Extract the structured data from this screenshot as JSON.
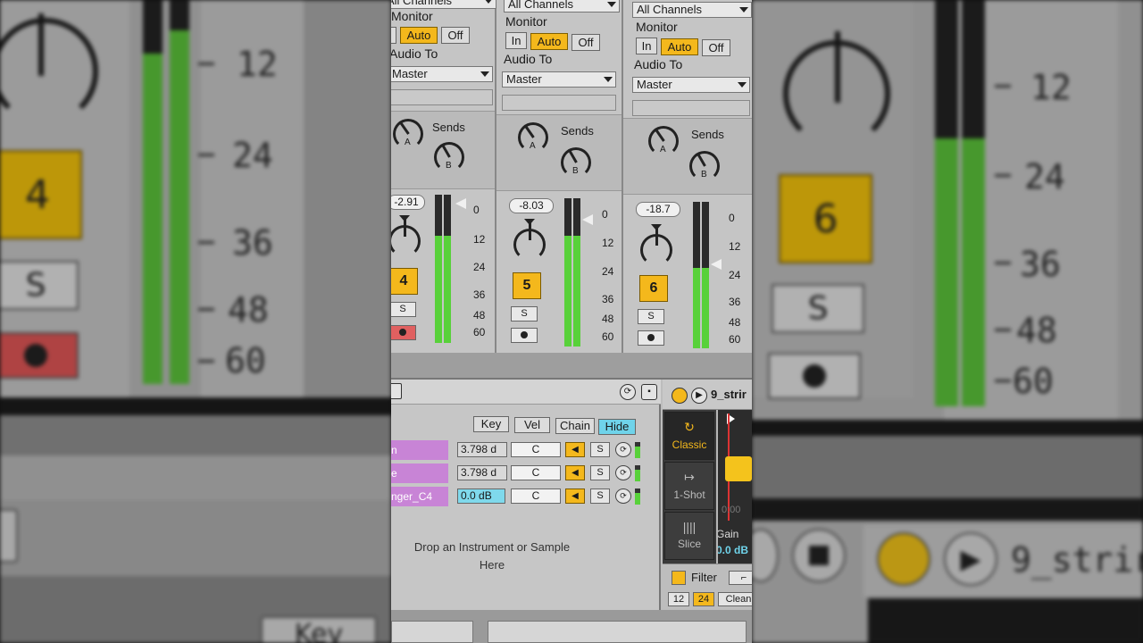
{
  "mixer": {
    "input_channel": "All Channels",
    "monitor_label": "Monitor",
    "monitor_in": "In",
    "monitor_auto": "Auto",
    "monitor_off": "Off",
    "audio_to_label": "Audio To",
    "audio_to_value": "Master",
    "sends_label": "Sends",
    "send_a": "A",
    "send_b": "B",
    "solo_label": "S",
    "scale": [
      "0",
      "12",
      "24",
      "36",
      "48",
      "60"
    ],
    "tracks": [
      {
        "volume": "-2.91",
        "number": "4",
        "meter_level": 0.72
      },
      {
        "volume": "-8.03",
        "number": "5",
        "meter_level": 0.75
      },
      {
        "volume": "-18.7",
        "number": "6",
        "meter_level": 0.55
      }
    ]
  },
  "drum_rack": {
    "key_label": "Key",
    "vel_label": "Vel",
    "chain_label": "Chain",
    "hide_label": "Hide",
    "chains": [
      {
        "name": "n",
        "volume": "3.798 d",
        "note": "C",
        "solo": "S"
      },
      {
        "name": "e",
        "volume": "3.798 d",
        "note": "C",
        "solo": "S"
      },
      {
        "name": "nger_C4",
        "volume": "0.0 dB",
        "note": "C",
        "solo": "S"
      }
    ],
    "drop_text_1": "Drop an Instrument or Sample",
    "drop_text_2": "Here"
  },
  "sampler": {
    "clip_name": "9_strir",
    "mode_classic": "Classic",
    "mode_oneshot": "1-Shot",
    "mode_slice": "Slice",
    "time": "0:00",
    "gain_label": "Gain",
    "gain_value": "0.0 dB",
    "filter_label": "Filter",
    "slope_12": "12",
    "slope_24": "24",
    "clean_label": "Clean"
  },
  "background_zoom": {
    "left": {
      "scale": [
        "12",
        "24",
        "36",
        "48",
        "60"
      ],
      "track_number": "4",
      "solo": "S"
    },
    "right": {
      "scale": [
        "12",
        "24",
        "36",
        "48",
        "60"
      ],
      "track_number": "6",
      "solo": "S",
      "clip_name": "9_strir"
    }
  },
  "colors": {
    "accent_yellow": "#f4b81c",
    "meter_green": "#58d13a",
    "chain_purple": "#c884d6",
    "hide_cyan": "#6fd3ea"
  }
}
